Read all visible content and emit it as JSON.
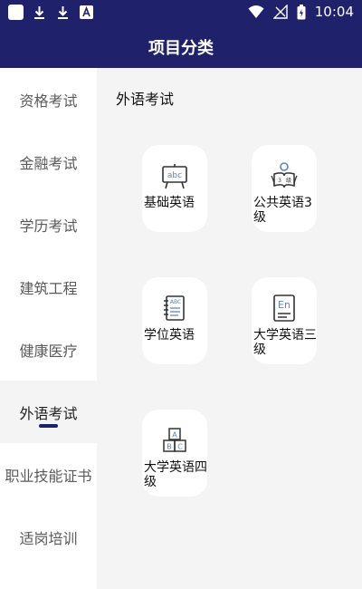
{
  "status_bar": {
    "time": "10:04"
  },
  "header": {
    "title": "项目分类"
  },
  "sidebar": {
    "items": [
      {
        "label": "资格考试"
      },
      {
        "label": "金融考试"
      },
      {
        "label": "学历考试"
      },
      {
        "label": "建筑工程"
      },
      {
        "label": "健康医疗"
      },
      {
        "label": "外语考试"
      },
      {
        "label": "职业技能证书"
      },
      {
        "label": "适岗培训"
      }
    ],
    "active_index": 5
  },
  "main": {
    "category_title": "外语考试",
    "cards": [
      {
        "label": "基础英语",
        "icon": "abc-board-icon"
      },
      {
        "label": "公共英语3级",
        "icon": "reading-person-icon"
      },
      {
        "label": "学位英语",
        "icon": "notebook-icon"
      },
      {
        "label": "大学英语三级",
        "icon": "en-book-icon"
      },
      {
        "label": "大学英语四级",
        "icon": "abc-blocks-icon"
      }
    ]
  },
  "colors": {
    "header_bg": "#1f216b",
    "icon_accent": "#5b84c4",
    "content_bg": "#f4f4f4"
  }
}
